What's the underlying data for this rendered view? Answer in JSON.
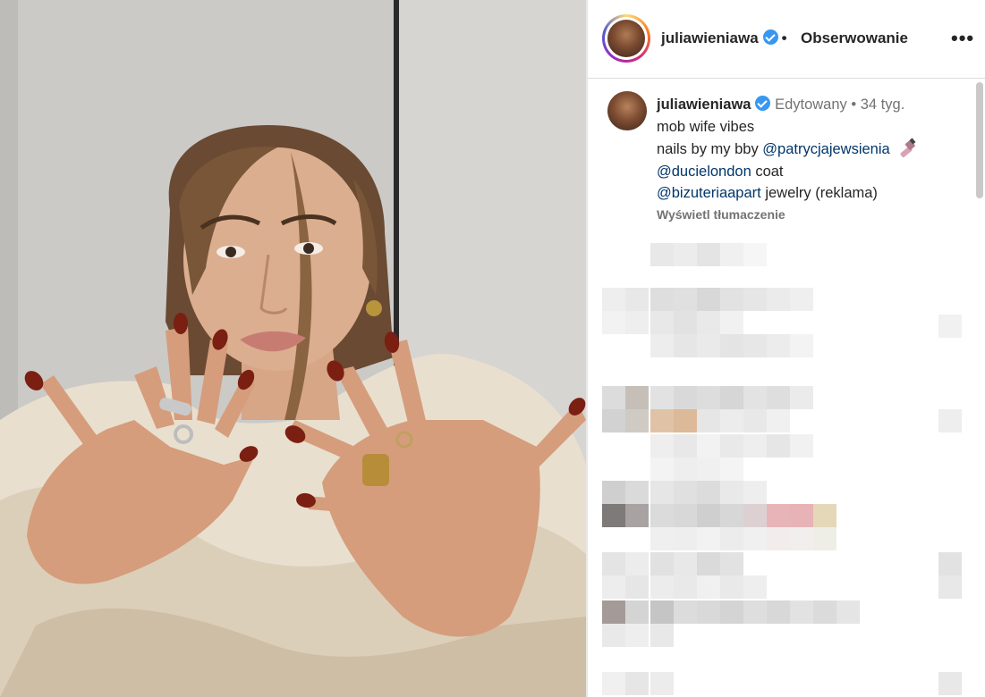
{
  "post": {
    "username": "juliawieniawa",
    "separator": "•",
    "follow_label": "Obserwowanie",
    "more_label": "•••"
  },
  "caption": {
    "username": "juliawieniawa",
    "edited_label": "Edytowany",
    "meta_separator": "•",
    "time_ago": "34 tyg.",
    "line1": "mob wife vibes",
    "line2_prefix": "nails by my bby ",
    "mention_nails": "@patrycjajewsienia",
    "mention_coat": "@ducielondon",
    "line3_suffix": " coat",
    "mention_jewelry": "@bizuteriaapart",
    "line4_suffix": " jewelry (reklama)",
    "translate_label": "Wyświetl tłumaczenie"
  },
  "icons": {
    "verified": "verified-badge-icon",
    "nail_polish": "nail-polish-emoji-icon",
    "more": "more-options-icon"
  },
  "colors": {
    "verified": "#3897f0",
    "mention": "#00376b",
    "muted": "#737373",
    "nails": "#7a1f12"
  }
}
